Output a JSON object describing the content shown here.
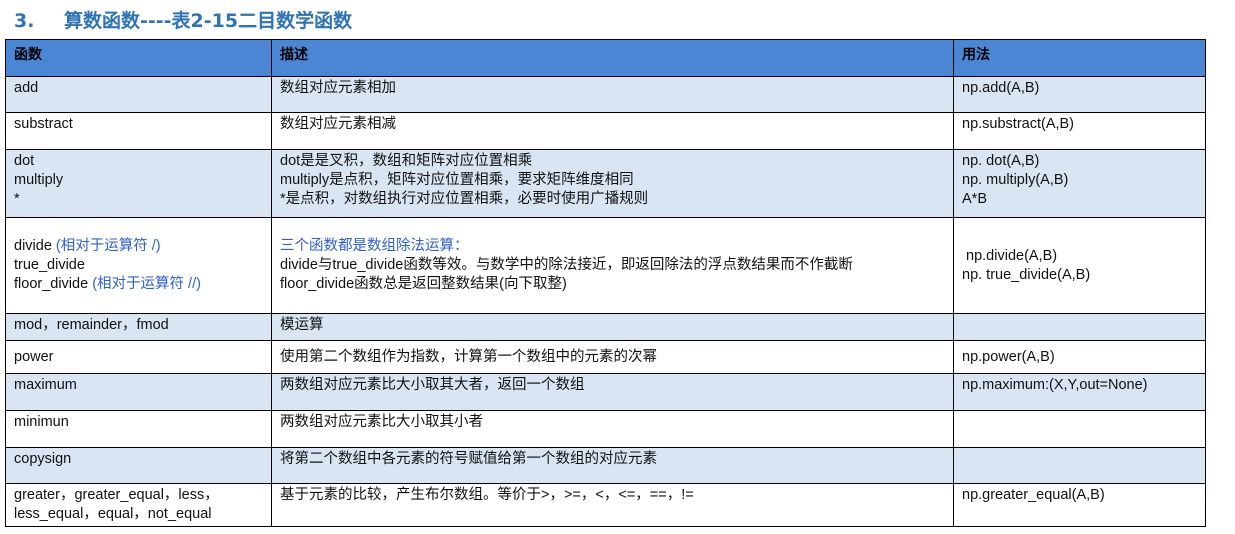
{
  "heading": {
    "number": "3.",
    "title": "算数函数----表2-15二目数学函数"
  },
  "table": {
    "headers": [
      "函数",
      "描述",
      "用法"
    ],
    "rows": {
      "add": {
        "func": "add",
        "desc": "数组对应元素相加",
        "usage": "np.add(A,B)"
      },
      "substract": {
        "func": "substract",
        "desc": "数组对应元素相减",
        "usage": "np.substract(A,B)"
      },
      "dot": {
        "func": [
          "dot",
          "multiply",
          "*"
        ],
        "desc": [
          "dot是是叉积，数组和矩阵对应位置相乘",
          "multiply是点积，矩阵对应位置相乘，要求矩阵维度相同",
          "*是点积，对数组执行对应位置相乘，必要时使用广播规则"
        ],
        "usage": [
          "np. dot(A,B)",
          "np. multiply(A,B)",
          "A*B"
        ]
      },
      "divide": {
        "func1": "divide ",
        "func1_note": "(相对于运算符 /)",
        "func2": "true_divide",
        "func3": "floor_divide  ",
        "func3_note": "(相对于运算符 //)",
        "desc_title": "三个函数都是数组除法运算：",
        "desc": [
          "divide与true_divide函数等效。与数学中的除法接近，即返回除法的浮点数结果而不作截断",
          "floor_divide函数总是返回整数结果(向下取整)"
        ],
        "usage": [
          " np.divide(A,B)",
          "np. true_divide(A,B)"
        ]
      },
      "mod": {
        "func": "mod，remainder，fmod",
        "desc": "模运算",
        "usage": ""
      },
      "power": {
        "func": "power",
        "desc": "使用第二个数组作为指数，计算第一个数组中的元素的次幂",
        "usage": "np.power(A,B)"
      },
      "maximum": {
        "func": "maximum",
        "desc": "两数组对应元素比大小取其大者，返回一个数组",
        "usage": "np.maximum:(X,Y,out=None)"
      },
      "minimun": {
        "func": "minimun",
        "desc": "两数组对应元素比大小取其小者",
        "usage": ""
      },
      "copysign": {
        "func": "copysign",
        "desc": "将第二个数组中各元素的符号赋值给第一个数组的对应元素",
        "usage": ""
      },
      "greater": {
        "func": [
          "greater，greater_equal，less，",
          "less_equal，equal，not_equal"
        ],
        "desc": "基于元素的比较，产生布尔数组。等价于>，>=，<，<=，==，!=",
        "usage": "np.greater_equal(A,B)"
      }
    }
  },
  "colors": {
    "heading": "#2E74B5",
    "header_bg": "#4A86D3",
    "row_shade": "#D9E5F3",
    "note_blue": "#2F5FCF"
  }
}
